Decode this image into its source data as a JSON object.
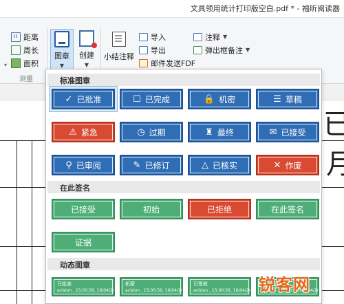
{
  "window": {
    "title": "文具领用统计打印版空白.pdf * - 福昕阅读器"
  },
  "ribbon": {
    "measure": {
      "distance": "距离",
      "perimeter": "周长",
      "area": "面积",
      "group_label": "测量"
    },
    "stamp_button": "图章",
    "create_button": "创建",
    "summary_button": "小结注释",
    "import": "导入",
    "export": "导出",
    "email_pdf": "邮件发送FDF",
    "annotation": "注释",
    "popup_note": "弹出框备注"
  },
  "panel": {
    "standard_title": "标准图章",
    "standard": [
      {
        "label": "已批准",
        "icon": "✓",
        "color": "blue"
      },
      {
        "label": "已完成",
        "icon": "☐",
        "color": "blue"
      },
      {
        "label": "机密",
        "icon": "🔒",
        "color": "blue"
      },
      {
        "label": "草稿",
        "icon": "☰",
        "color": "blue"
      },
      {
        "label": "紧急",
        "icon": "⚠",
        "color": "red"
      },
      {
        "label": "过期",
        "icon": "◷",
        "color": "blue"
      },
      {
        "label": "最终",
        "icon": "♜",
        "color": "blue"
      },
      {
        "label": "已接受",
        "icon": "✉",
        "color": "blue"
      },
      {
        "label": "已审阅",
        "icon": "⚲",
        "color": "blue"
      },
      {
        "label": "已修订",
        "icon": "✎",
        "color": "blue"
      },
      {
        "label": "已核实",
        "icon": "△",
        "color": "blue"
      },
      {
        "label": "作废",
        "icon": "✕",
        "color": "red"
      }
    ],
    "sign_title": "在此签名",
    "sign": [
      {
        "label": "已接受",
        "color": "green"
      },
      {
        "label": "初始",
        "color": "green"
      },
      {
        "label": "已拒绝",
        "color": "red"
      },
      {
        "label": "在此签名",
        "color": "green"
      },
      {
        "label": "证据",
        "color": "green"
      }
    ],
    "dynamic_title": "动态图章",
    "dynamic": [
      {
        "label": "已批准",
        "stamp": "avision , 15:00:56, 16/04/2014"
      },
      {
        "label": "机密",
        "stamp": "avision , 15:00:56, 16/04/2014"
      },
      {
        "label": "已签收",
        "stamp": "avision , 15:00:56, 16/04/2014"
      },
      {
        "label": "已审阅",
        "stamp": "avision , 15:00:56, 16/04/2014"
      }
    ]
  },
  "watermark": "锐客网",
  "doc": {
    "glyph_right_1": "已",
    "glyph_right_2": "月"
  }
}
